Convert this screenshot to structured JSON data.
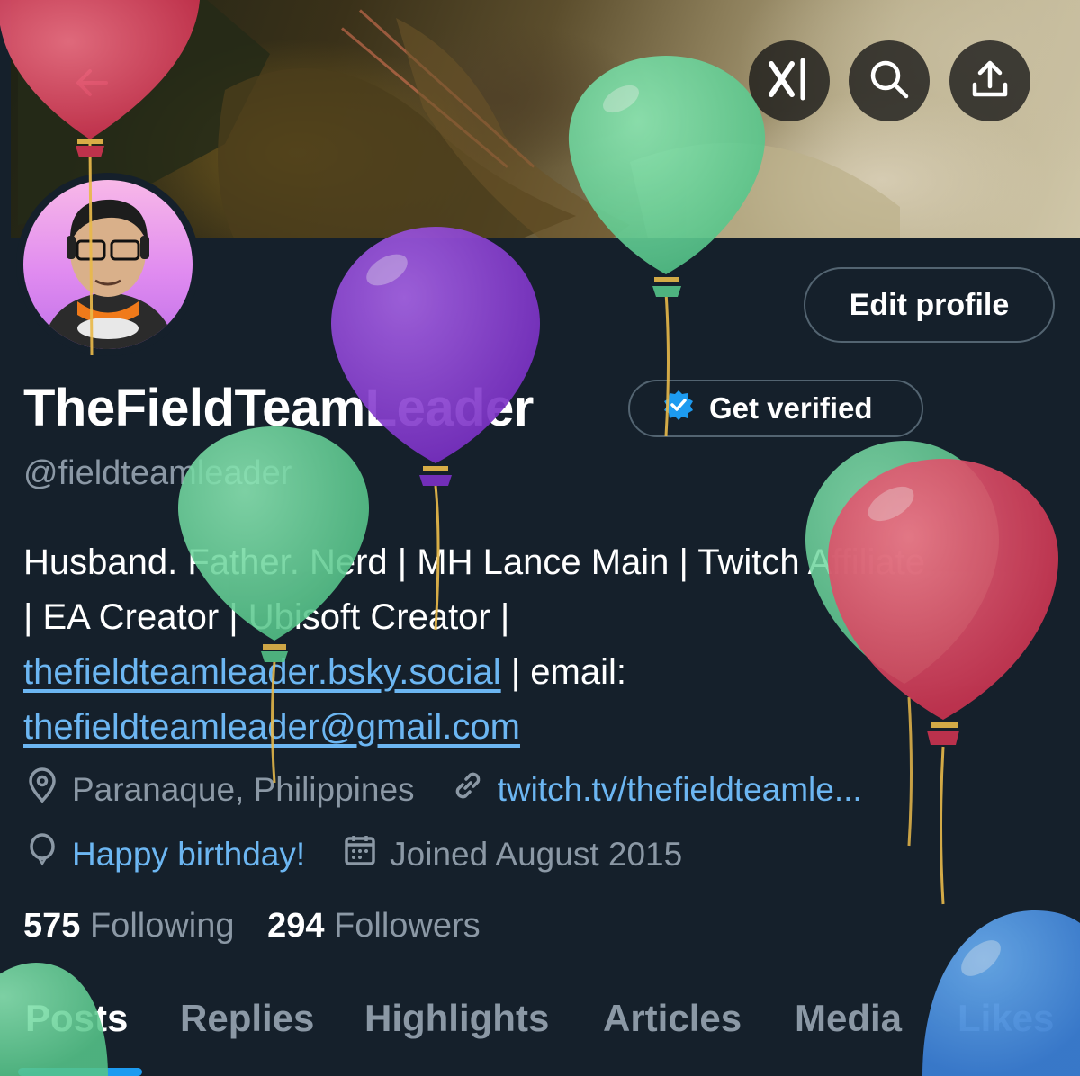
{
  "header": {
    "back_icon": "arrow-left-icon",
    "grok_icon": "grok-icon",
    "search_icon": "search-icon",
    "share_icon": "share-upload-icon"
  },
  "profile": {
    "edit_label": "Edit profile",
    "name": "TheFieldTeamLeader",
    "verify_label": "Get verified",
    "handle": "@fieldteamleader",
    "bio_line1": "Husband. Father. Nerd | MH Lance Main | Twitch Affiliate",
    "bio_line2": "| EA Creator | Ubisoft Creator |",
    "bio_link1": "thefieldteamleader.bsky.social",
    "bio_email_label": " | email:",
    "bio_link2": "thefieldteamleader@gmail.com",
    "location": "Paranaque, Philippines",
    "website": "twitch.tv/thefieldteamle...",
    "birthday": "Happy birthday!",
    "joined": "Joined August 2015",
    "following_count": "575",
    "following_label": "Following",
    "followers_count": "294",
    "followers_label": "Followers"
  },
  "tabs": [
    {
      "label": "Posts",
      "active": true
    },
    {
      "label": "Replies",
      "active": false
    },
    {
      "label": "Highlights",
      "active": false
    },
    {
      "label": "Articles",
      "active": false
    },
    {
      "label": "Media",
      "active": false
    },
    {
      "label": "Likes",
      "active": false
    }
  ],
  "colors": {
    "background": "#15202b",
    "accent": "#1d9bf0",
    "link": "#6cb6f2",
    "muted": "#8b98a5",
    "balloon_red": "#d94057",
    "balloon_green": "#6dd39b",
    "balloon_purple": "#8a3fd0",
    "balloon_blue": "#4a90e2"
  }
}
